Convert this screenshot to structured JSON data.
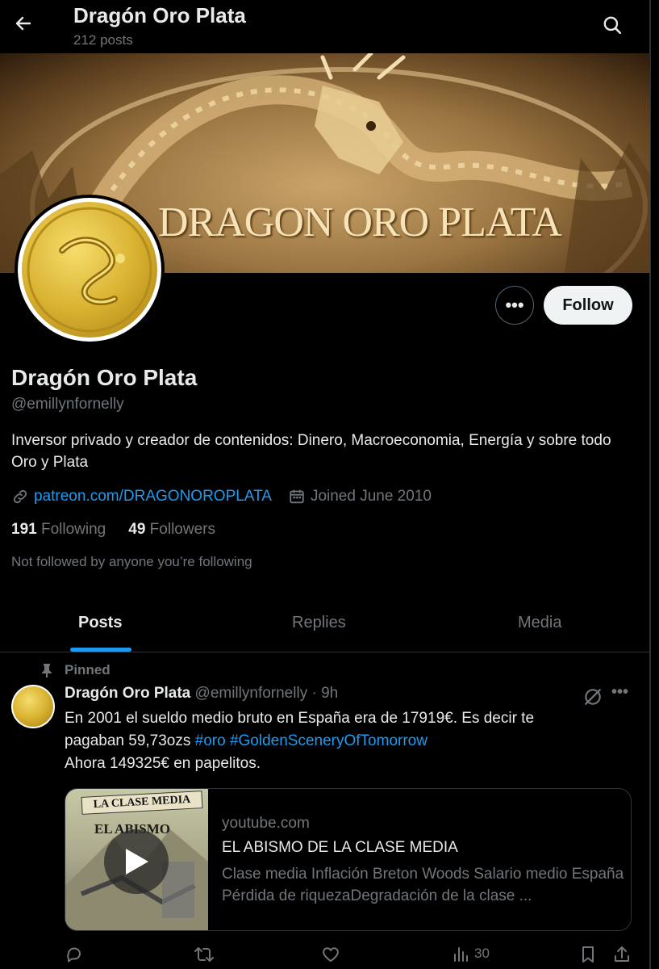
{
  "header": {
    "title": "Dragón Oro Plata",
    "post_count": "212 posts"
  },
  "banner": {
    "text": "DRAGON ORO PLATA"
  },
  "profile": {
    "name": "Dragón Oro Plata",
    "handle": "@emillynfornelly",
    "bio": "Inversor privado y creador de contenidos: Dinero, Macroeconomia, Energía y sobre todo Oro y Plata",
    "link": "patreon.com/DRAGONOROPLATA",
    "joined": "Joined June 2010",
    "following_count": "191",
    "following_label": "Following",
    "followers_count": "49",
    "followers_label": "Followers",
    "not_followed": "Not followed by anyone you’re following",
    "follow_label": "Follow",
    "more_label": "•••"
  },
  "tabs": [
    {
      "label": "Posts",
      "active": true
    },
    {
      "label": "Replies",
      "active": false
    },
    {
      "label": "Media",
      "active": false
    }
  ],
  "post": {
    "pinned_label": "Pinned",
    "author": "Dragón Oro Plata",
    "handle": "@emillynfornelly",
    "time": "· 9h",
    "more_label": "•••",
    "text_line1": "En 2001 el sueldo medio bruto en España era de 17919€. Es decir te",
    "text_line2_prefix": "pagaban 59,73ozs ",
    "hashtag1": "#oro",
    "hashtag2": "#GoldenSceneryOfTomorrow",
    "text_line3": "Ahora 149325€ en papelitos.",
    "card": {
      "thumb_banner": "LA CLASE MEDIA",
      "thumb_label": "EL ABISMO",
      "domain": "youtube.com",
      "title": "EL ABISMO DE LA CLASE MEDIA",
      "description": "Clase media Inflación Breton Woods Salario medio España Pérdida de riquezaDegradación de la clase ..."
    },
    "views": "30"
  },
  "colors": {
    "background": "#000000",
    "accent": "#1d9bf0",
    "muted": "#71767b",
    "follow_bg": "#eff3f4"
  },
  "icons": [
    "back-arrow-icon",
    "search-icon",
    "link-icon",
    "calendar-icon",
    "pin-icon",
    "grok-icon",
    "play-icon",
    "reply-icon",
    "repost-icon",
    "like-icon",
    "views-icon",
    "bookmark-icon",
    "share-icon"
  ]
}
